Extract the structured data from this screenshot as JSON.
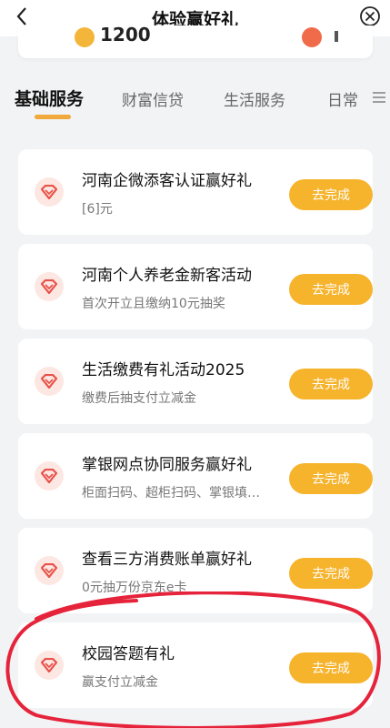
{
  "header": {
    "title": "体验赢好礼",
    "back_glyph": "<",
    "close_glyph": "×"
  },
  "points": {
    "value": "1200"
  },
  "tabs": [
    {
      "label": "基础服务",
      "active": true
    },
    {
      "label": "财富信贷",
      "active": false
    },
    {
      "label": "生活服务",
      "active": false
    },
    {
      "label": "日常",
      "active": false
    }
  ],
  "tasks": [
    {
      "title": "河南企微添客认证赢好礼",
      "subtitle": "[6]元",
      "button": "去完成"
    },
    {
      "title": "河南个人养老金新客活动",
      "subtitle": "首次开立且缴纳10元抽奖",
      "button": "去完成"
    },
    {
      "title": "生活缴费有礼活动2025",
      "subtitle": "缴费后抽支付立减金",
      "button": "去完成"
    },
    {
      "title": "掌银网点协同服务赢好礼",
      "subtitle": "柜面扫码、超柜扫码、掌银填…",
      "button": "去完成"
    },
    {
      "title": "查看三方消费账单赢好礼",
      "subtitle": "0元抽万份京东e卡",
      "button": "去完成"
    },
    {
      "title": "校园答题有礼",
      "subtitle": "赢支付立减金",
      "button": "去完成"
    }
  ],
  "colors": {
    "accent": "#f6b32c",
    "tab_underline": "#f0a93a",
    "icon_red": "#e8524a",
    "annotation_red": "#e5233a"
  }
}
